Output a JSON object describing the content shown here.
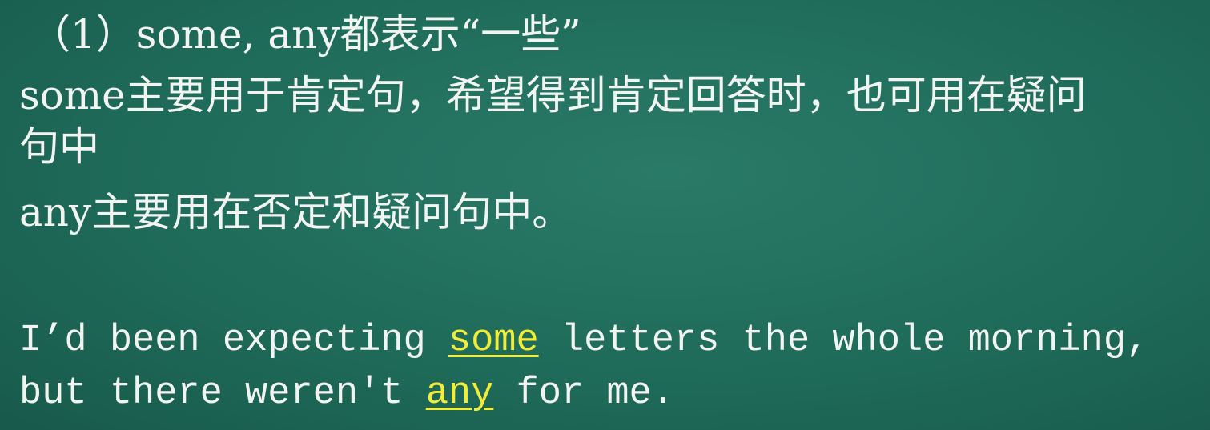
{
  "slide": {
    "heading": "（1）some, any都表示“一些”",
    "some_rule_line1": "some主要用于肯定句，希望得到肯定回答时，也可用在疑问",
    "some_rule_line2": "句中",
    "any_rule": "any主要用在否定和疑问句中。",
    "example": {
      "line1_before": "I’d been expecting ",
      "line1_highlight": "some",
      "line1_after": " letters the whole morning,",
      "line2_before": "but there weren't ",
      "line2_highlight": "any",
      "line2_after": " for me."
    }
  },
  "colors": {
    "background": "#1f6b5a",
    "text": "#f2f4f2",
    "highlight": "#f2ec3a"
  }
}
